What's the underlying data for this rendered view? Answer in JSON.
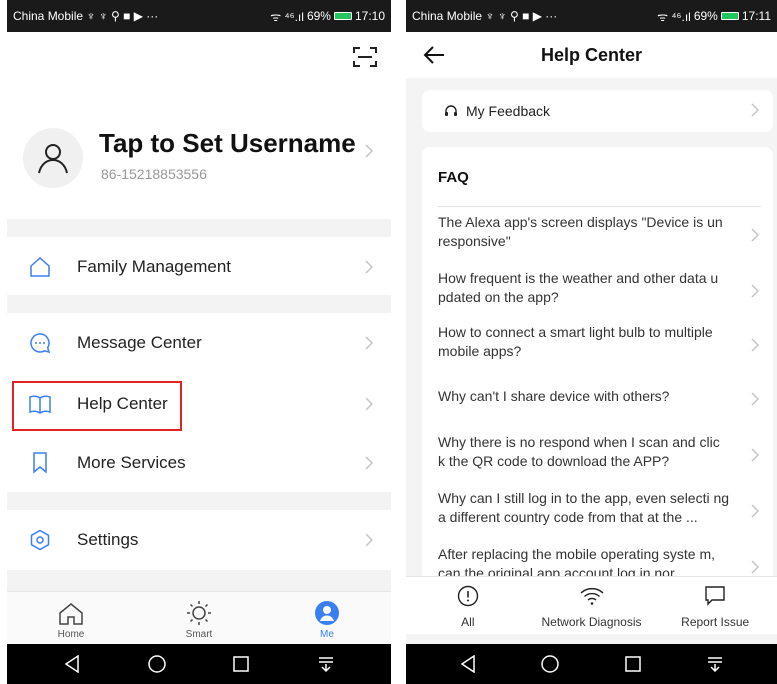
{
  "left": {
    "status": {
      "carrier": "China Mobile ♆ ♆ ⚲ ■ ▶ ···",
      "signal": "ᯤ ⁴⁶.ıl",
      "battery": "69%",
      "time": "17:10"
    },
    "profile": {
      "username": "Tap to Set Username",
      "phone": "86-15218853556"
    },
    "menu": [
      {
        "label": "Family Management",
        "icon": "home-outline-icon"
      },
      {
        "label": "Message Center",
        "icon": "chat-bubble-icon"
      },
      {
        "label": "Help Center",
        "icon": "book-icon"
      },
      {
        "label": "More Services",
        "icon": "bookmark-icon"
      },
      {
        "label": "Settings",
        "icon": "hexagon-settings-icon"
      }
    ],
    "tabs": [
      {
        "label": "Home",
        "icon": "home-tab-icon"
      },
      {
        "label": "Smart",
        "icon": "sun-icon"
      },
      {
        "label": "Me",
        "icon": "user-circle-icon",
        "active": true
      }
    ],
    "accent": "#3b7ff5",
    "highlight_color": "#e02424"
  },
  "right": {
    "status": {
      "carrier": "China Mobile ♆ ♆ ⚲ ■ ▶ ···",
      "signal": "ᯤ ⁴⁶.ıl",
      "battery": "69%",
      "time": "17:11"
    },
    "header": {
      "title": "Help Center"
    },
    "feedback": {
      "label": "My Feedback"
    },
    "faq": {
      "title": "FAQ",
      "items": [
        {
          "question": "The Alexa app's screen displays \"Device is un responsive\""
        },
        {
          "question": "How frequent is the weather and other data u pdated on the app?"
        },
        {
          "question": "How to connect a smart light bulb to multiple mobile apps?"
        },
        {
          "question": "Why can't I share device with others?"
        },
        {
          "question": "Why there is no respond when I scan and clic k the QR code to download the APP?"
        },
        {
          "question": "Why can I still log in to the app,  even selecti ng a different country code from that at the ..."
        },
        {
          "question": "After replacing the mobile operating syste m,  can the original app account log in nor..."
        }
      ]
    },
    "tabs": [
      {
        "label": "All",
        "icon": "info-circle-icon"
      },
      {
        "label": "Network Diagnosis",
        "icon": "wifi-icon"
      },
      {
        "label": "Report Issue",
        "icon": "message-square-icon"
      }
    ]
  }
}
